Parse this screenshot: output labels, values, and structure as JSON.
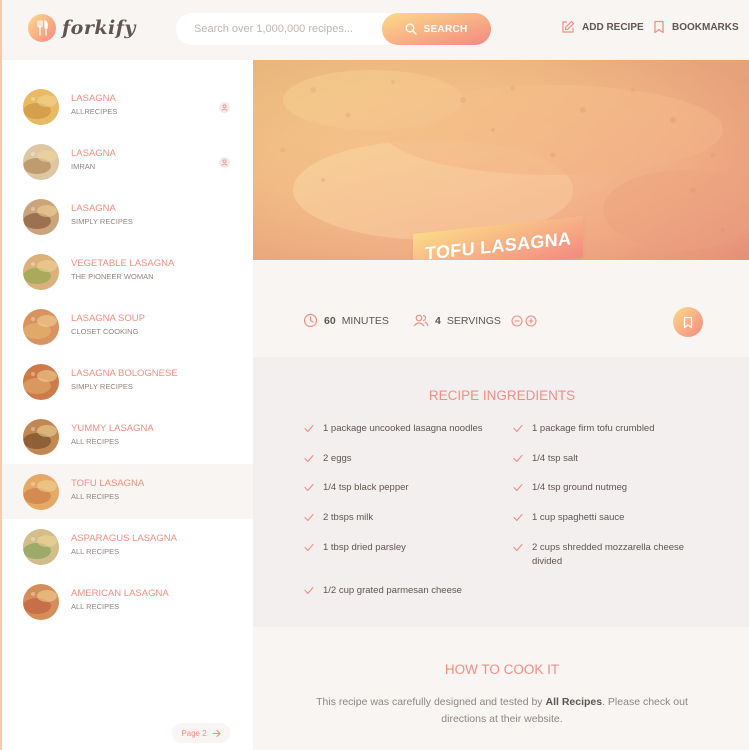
{
  "app": {
    "name": "forkify"
  },
  "search": {
    "placeholder": "Search over 1,000,000 recipes...",
    "button_label": "SEARCH"
  },
  "nav": {
    "add_recipe": "ADD RECIPE",
    "bookmarks": "BOOKMARKS"
  },
  "results": [
    {
      "title": "LASAGNA",
      "publisher": "ALLRECIPES",
      "user_generated": true,
      "active": false
    },
    {
      "title": "LASAGNA",
      "publisher": "IMRAN",
      "user_generated": true,
      "active": false
    },
    {
      "title": "LASAGNA",
      "publisher": "SIMPLY RECIPES",
      "user_generated": false,
      "active": false
    },
    {
      "title": "VEGETABLE LASAGNA",
      "publisher": "THE PIONEER WOMAN",
      "user_generated": false,
      "active": false
    },
    {
      "title": "LASAGNA SOUP",
      "publisher": "CLOSET COOKING",
      "user_generated": false,
      "active": false
    },
    {
      "title": "LASAGNA BOLOGNESE",
      "publisher": "SIMPLY RECIPES",
      "user_generated": false,
      "active": false
    },
    {
      "title": "YUMMY LASAGNA",
      "publisher": "ALL RECIPES",
      "user_generated": false,
      "active": false
    },
    {
      "title": "TOFU LASAGNA",
      "publisher": "ALL RECIPES",
      "user_generated": false,
      "active": true
    },
    {
      "title": "ASPARAGUS LASAGNA",
      "publisher": "ALL RECIPES",
      "user_generated": false,
      "active": false
    },
    {
      "title": "AMERICAN LASAGNA",
      "publisher": "ALL RECIPES",
      "user_generated": false,
      "active": false
    }
  ],
  "pagination": {
    "next_label": "Page 2"
  },
  "recipe": {
    "title": "TOFU LASAGNA",
    "cooking_time": "60",
    "cooking_time_unit": "MINUTES",
    "servings": "4",
    "servings_unit": "SERVINGS",
    "ingredients_heading": "RECIPE INGREDIENTS",
    "ingredients": [
      "1 package uncooked lasagna noodles",
      "1 package firm tofu crumbled",
      "2 eggs",
      "1/4 tsp salt",
      "1/4 tsp black pepper",
      "1/4 tsp ground nutmeg",
      "2 tbsps milk",
      "1 cup spaghetti sauce",
      "1 tbsp dried parsley",
      "2 cups shredded mozzarella cheese divided",
      "1/2 cup grated parmesan cheese"
    ],
    "directions_heading": "HOW TO COOK IT",
    "directions_prefix": "This recipe was carefully designed and tested by",
    "directions_publisher": "All Recipes",
    "directions_suffix": ". Please check out directions at their website."
  },
  "colors": {
    "accent": "#f38e82",
    "gradient_start": "#fbdb89",
    "gradient_end": "#f48982",
    "text": "#615551"
  },
  "icons": [
    "forkify-logo-icon",
    "search-icon",
    "edit-icon",
    "bookmark-icon",
    "clock-icon",
    "users-icon",
    "minus-circle-icon",
    "plus-circle-icon",
    "check-icon",
    "user-icon",
    "arrow-right-icon"
  ]
}
